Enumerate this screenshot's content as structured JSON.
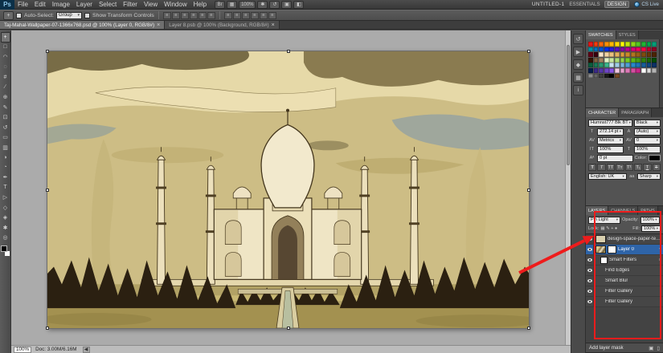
{
  "app": {
    "logo": "Ps",
    "doc_title": "UNTITLED-1",
    "workspaces": [
      "ESSENTIALS",
      "DESIGN"
    ],
    "active_workspace": "DESIGN",
    "cs_live": "CS Live"
  },
  "menu": {
    "items": [
      "File",
      "Edit",
      "Image",
      "Layer",
      "Select",
      "Filter",
      "View",
      "Window",
      "Help"
    ]
  },
  "app_icons": [
    {
      "name": "launch-bridge-button",
      "glyph": "Br"
    },
    {
      "name": "view-extras-button",
      "glyph": "▦"
    },
    {
      "name": "zoom-level",
      "glyph": "100%"
    },
    {
      "name": "hand-tool-button",
      "glyph": "✱"
    },
    {
      "name": "rotate-view-button",
      "glyph": "↺"
    },
    {
      "name": "arrange-documents-button",
      "glyph": "▣"
    },
    {
      "name": "screen-mode-button",
      "glyph": "◧"
    }
  ],
  "options_bar": {
    "tool_badge": "+",
    "auto_select_label": "Auto-Select:",
    "auto_select_value": "Group",
    "transform_label": "Show Transform Controls",
    "align_icons": [
      "≡",
      "≡",
      "≡",
      "≡",
      "≡",
      "≡"
    ],
    "distribute_icons": [
      "≡",
      "≡",
      "≡",
      "≡",
      "≡",
      "≡"
    ]
  },
  "doc_tabs": [
    {
      "label": "Taj-Mahal-Wallpaper-07-1366x768.psd @ 100% (Layer 0, RGB/8#)",
      "close": "×",
      "active": true
    },
    {
      "label": "Layer 8.psb @ 100% (Background, RGB/8#)",
      "close": "×",
      "active": false
    }
  ],
  "tools": [
    {
      "name": "move-tool",
      "glyph": "+",
      "selected": true
    },
    {
      "name": "marquee-tool",
      "glyph": "□"
    },
    {
      "name": "lasso-tool",
      "glyph": "◠"
    },
    {
      "name": "quick-selection-tool",
      "glyph": "◌"
    },
    {
      "name": "crop-tool",
      "glyph": "#"
    },
    {
      "name": "eyedropper-tool",
      "glyph": "∕"
    },
    {
      "name": "spot-healing-tool",
      "glyph": "⊕"
    },
    {
      "name": "brush-tool",
      "glyph": "✎"
    },
    {
      "name": "clone-stamp-tool",
      "glyph": "⊡"
    },
    {
      "name": "history-brush-tool",
      "glyph": "↺"
    },
    {
      "name": "eraser-tool",
      "glyph": "▭"
    },
    {
      "name": "gradient-tool",
      "glyph": "▥"
    },
    {
      "name": "blur-tool",
      "glyph": "◑"
    },
    {
      "name": "dodge-tool",
      "glyph": "◔"
    },
    {
      "name": "pen-tool",
      "glyph": "✒"
    },
    {
      "name": "type-tool",
      "glyph": "T"
    },
    {
      "name": "path-selection-tool",
      "glyph": "▷"
    },
    {
      "name": "rectangle-tool",
      "glyph": "◇"
    },
    {
      "name": "3d-rotate-tool",
      "glyph": "◈"
    },
    {
      "name": "hand-tool",
      "glyph": "✱"
    },
    {
      "name": "zoom-tool",
      "glyph": "◎"
    }
  ],
  "collapsed_panels": [
    {
      "name": "history-panel-icon",
      "glyph": "↺"
    },
    {
      "name": "actions-panel-icon",
      "glyph": "▶"
    },
    {
      "name": "styles-panel-icon",
      "glyph": "◆"
    },
    {
      "name": "navigator-panel-icon",
      "glyph": "▦"
    },
    {
      "name": "info-panel-icon",
      "glyph": "i"
    }
  ],
  "swatches_panel": {
    "tabs": [
      "SWATCHES",
      "STYLES"
    ],
    "colors": [
      "#e81616",
      "#f23c0c",
      "#f7660a",
      "#fa9006",
      "#fcb804",
      "#fdd902",
      "#fdfa00",
      "#c2e60c",
      "#8cd618",
      "#55c626",
      "#1fb434",
      "#00a84e",
      "#009e78",
      "#0094a4",
      "#0074c0",
      "#0052d8",
      "#0030ee",
      "#2c1ada",
      "#5c10c2",
      "#8c06aa",
      "#bc0092",
      "#da007a",
      "#ee0060",
      "#fa0046",
      "#c00032",
      "#900024",
      "#600016",
      "#3c000e",
      "#f7e3c8",
      "#f0d2a4",
      "#e9c180",
      "#e2b05e",
      "#d99e3c",
      "#c98a2c",
      "#b07522",
      "#976018",
      "#7e4b10",
      "#653708",
      "#4c2404",
      "#331202",
      "#806040",
      "#a08060",
      "#e2f0c6",
      "#c8e69e",
      "#aedc76",
      "#92d24e",
      "#78c826",
      "#5eb41c",
      "#489a16",
      "#328010",
      "#1c660a",
      "#064c04",
      "#0a5c3c",
      "#1a7a56",
      "#2a9870",
      "#3cb68a",
      "#c8e2f0",
      "#a0cce6",
      "#78b6dc",
      "#50a0d2",
      "#2888c8",
      "#1e74b4",
      "#185e9a",
      "#124880",
      "#0c3266",
      "#061c4c",
      "#3c2a8a",
      "#5638a8",
      "#7046c6",
      "#8a54e4",
      "#f0c8e2",
      "#e6a0cc",
      "#dc78b6",
      "#d250a0",
      "#c62888",
      "#ffffff",
      "#d9d9d9",
      "#b3b3b3",
      "#8c8c8c",
      "#666666",
      "#404040",
      "#1a1a1a",
      "#000000",
      "#7a4a22"
    ]
  },
  "character_panel": {
    "tabs": [
      "CHARACTER",
      "PARAGRAPH"
    ],
    "font_family": "Humnst777 Blk BT",
    "font_style": "Black",
    "font_size": "272.14 pt",
    "leading": "(Auto)",
    "kerning": "Metrics",
    "tracking": "0",
    "vertical_scale": "100%",
    "horizontal_scale": "100%",
    "baseline_shift": "0 pt",
    "color_label": "Color:",
    "language": "English: UK",
    "anti_alias_label": "aa",
    "anti_alias": "Sharp",
    "icons": {
      "size": "T",
      "leading": "A",
      "kerning": "AV",
      "tracking": "AV",
      "vscale": "IT",
      "hscale": "T",
      "baseline": "Aª"
    },
    "style_buttons": [
      "T",
      "T",
      "TT",
      "Tᴛ",
      "T¹",
      "T₁",
      "T",
      "T"
    ]
  },
  "layers_panel": {
    "tabs": [
      "LAYERS",
      "CHANNELS",
      "PATHS"
    ],
    "blend_mode": "Pin Light",
    "opacity_label": "Opacity:",
    "opacity": "100%",
    "lock_label": "Lock:",
    "lock_icons": [
      "▦",
      "✎",
      "+",
      "●"
    ],
    "fill_label": "Fill:",
    "fill": "100%",
    "layers": [
      {
        "name": "design-space-paper-textur..."
      },
      {
        "name": "Layer 0"
      }
    ],
    "smart_filters_label": "Smart Filters",
    "smart_filters_icon": "≡",
    "filter_row_icon": "↕",
    "filters": [
      "Find Edges",
      "Smart Blur",
      "Filter Gallery",
      "Filter Gallery"
    ],
    "expand_icon": "▾",
    "tooltip": "Add layer mask",
    "bottom_icons": [
      {
        "name": "new-layer-button",
        "glyph": "▣"
      },
      {
        "name": "delete-layer-button",
        "glyph": "▯"
      }
    ]
  },
  "status_bar": {
    "zoom": "100%",
    "doc_label": "Doc: 3.00M/6.16M",
    "scroll_left": "◀"
  },
  "canvas": {
    "palette": {
      "sky": "#cdbd85",
      "cloud_dark": "#7c7049",
      "cloud_light": "#ecdfb2",
      "building": "#efe5c5",
      "outline": "#43351c",
      "trees": "#2b2011",
      "ground": "#a39150"
    }
  }
}
